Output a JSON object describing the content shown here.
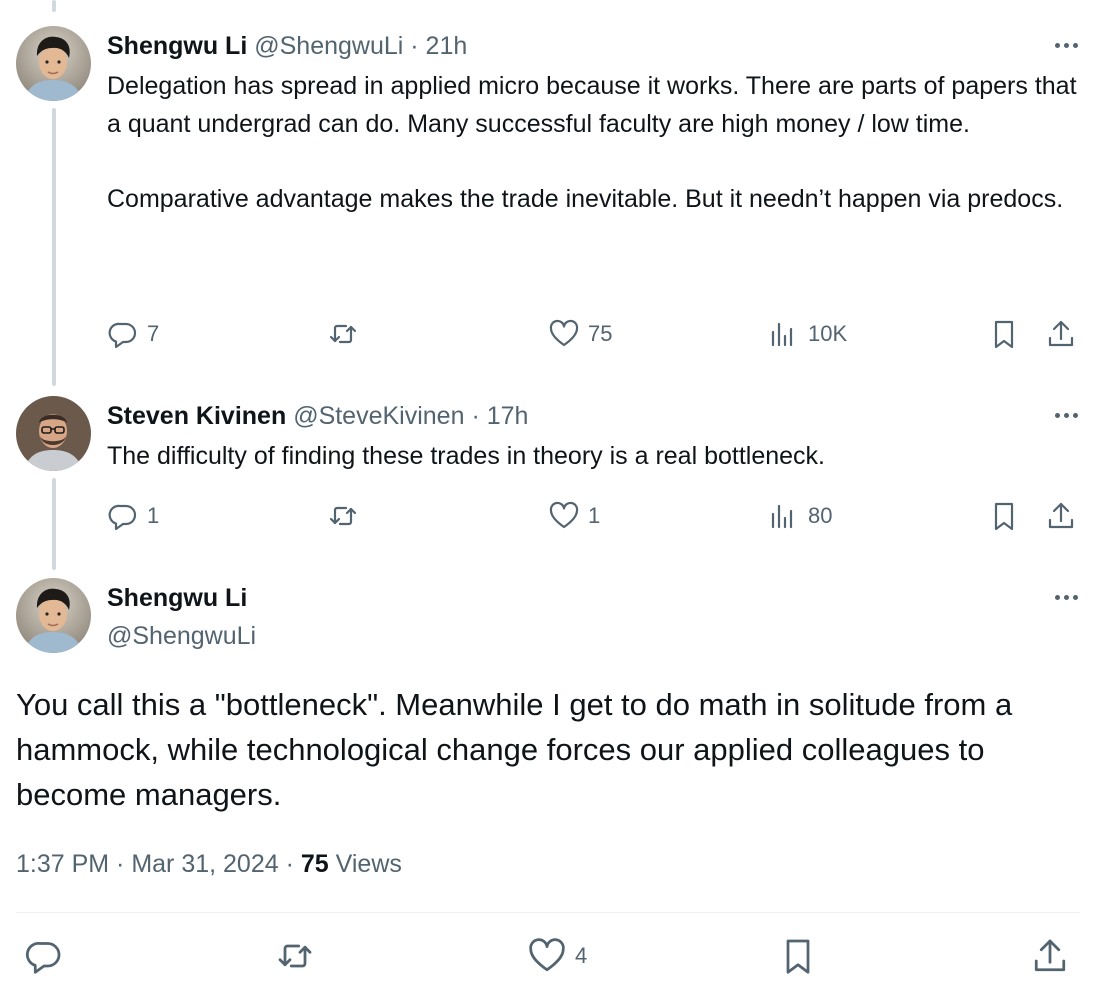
{
  "tweets": [
    {
      "name": "Shengwu Li",
      "handle": "@ShengwuLi",
      "sep": " · ",
      "time": "21h",
      "text": "Delegation has spread in applied micro because it works. There are parts of papers that a quant undergrad can do. Many successful faculty are high money / low time.\n\nComparative advantage makes the trade inevitable. But it needn’t happen via predocs.",
      "replies": "7",
      "retweets": "",
      "likes": "75",
      "views": "10K"
    },
    {
      "name": "Steven Kivinen",
      "handle": "@SteveKivinen",
      "sep": " · ",
      "time": "17h",
      "text": "The difficulty of finding these trades in theory is a real bottleneck.",
      "replies": "1",
      "retweets": "",
      "likes": "1",
      "views": "80"
    }
  ],
  "main": {
    "name": "Shengwu Li",
    "handle": "@ShengwuLi",
    "text": "You call this a \"bottleneck\". Meanwhile I get to do math in solitude from a hammock, while technological change forces our applied colleagues to become managers.",
    "time": "1:37 PM",
    "sep1": " · ",
    "date": "Mar 31, 2024",
    "sep2": " · ",
    "views_count": "75",
    "views_label": " Views",
    "likes": "4"
  },
  "icons": {
    "reply": "reply-icon",
    "retweet": "retweet-icon",
    "like": "heart-icon",
    "views": "views-icon",
    "bookmark": "bookmark-icon",
    "share": "share-icon",
    "more": "more-icon"
  },
  "colors": {
    "text": "#0f1419",
    "secondary": "#536471",
    "thread_line": "#cfd9de",
    "divider": "#eff3f4"
  }
}
